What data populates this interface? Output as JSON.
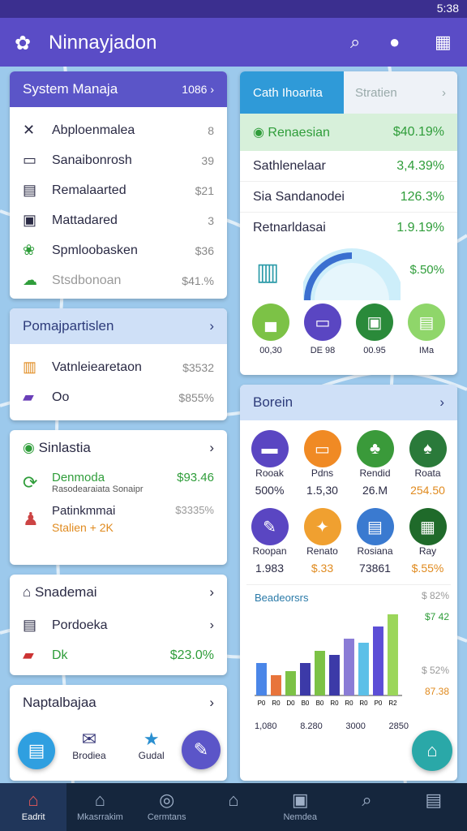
{
  "status_bar": {
    "time": "5:38"
  },
  "app_bar": {
    "title": "Ninnayjadon",
    "icons": [
      "search-icon",
      "profile-icon",
      "grid-icon"
    ]
  },
  "system": {
    "title": "System Manaja",
    "badge": "1086",
    "items": [
      {
        "label": "Abploenmalea",
        "value": "8"
      },
      {
        "label": "Sanaibonrosh",
        "value": "39"
      },
      {
        "label": "Remalaarted",
        "value": "$21"
      },
      {
        "label": "Mattadared",
        "value": "3"
      },
      {
        "label": "Spmloobasken",
        "value": "$36"
      },
      {
        "label": "Stsdbonoan",
        "value": "$41.%"
      }
    ]
  },
  "pomaj": {
    "title": "Pomajpartislen",
    "rows": [
      {
        "label": "Vatnleiearetaon",
        "value": "$3532"
      },
      {
        "label": "Oo",
        "value": "$855%"
      }
    ]
  },
  "sinlastia": {
    "title": "Sinlastia",
    "item1": {
      "label": "Denmoda",
      "value": "$93.46",
      "sub": "Rasodearaiata Sonaipr"
    },
    "item2": {
      "label": "Patinkmmai",
      "value": "$3335%",
      "sub": "Stalien + 2K"
    }
  },
  "snadema": {
    "title": "Snademai",
    "row2": "Pordoeka",
    "row3": {
      "label": "Dk",
      "value": "$23.0%"
    }
  },
  "napta": {
    "title": "Naptalbajaa",
    "buttons": [
      {
        "label": "Brodiea"
      },
      {
        "label": "Gudal"
      }
    ]
  },
  "finance": {
    "tab_active": "Cath Ihoarita",
    "tab_inactive": "Stratien",
    "highlight": {
      "label": "Renaesian",
      "value": "$40.19%"
    },
    "rows": [
      {
        "label": "Sathlenelaar",
        "value": "3,4.39%"
      },
      {
        "label": "Sia Sandanodei",
        "value": "126.3%"
      },
      {
        "label": "Retnarldasai",
        "value": "1.9.19%"
      }
    ],
    "gauge_value": "$.50%",
    "circles": [
      {
        "label": "00,30"
      },
      {
        "label": "DE 98"
      },
      {
        "label": "00.95"
      },
      {
        "label": "IMa"
      }
    ]
  },
  "borein": {
    "title": "Borein",
    "tiles": [
      {
        "label": "Rooak",
        "value": "500%"
      },
      {
        "label": "Pdns",
        "value": "1.5,30"
      },
      {
        "label": "Rendid",
        "value": "26.M"
      },
      {
        "label": "Roata",
        "value": "254.50"
      },
      {
        "label": "Roopan",
        "value": "1.983"
      },
      {
        "label": "Renato",
        "value": "$.33"
      },
      {
        "label": "Rosiana",
        "value": "73861"
      },
      {
        "label": "Ray",
        "value": "$.55%"
      }
    ]
  },
  "chart": {
    "title": "Beadeorsrs",
    "labels": [
      "$ 82%",
      "$7 42",
      "$ 52%",
      "87.38"
    ],
    "bottom": [
      "1,080",
      "8.280",
      "3000",
      "2850"
    ]
  },
  "chart_data": {
    "type": "bar",
    "categories": [
      "P0",
      "R0",
      "D0",
      "B0",
      "B0",
      "R0",
      "R0",
      "R0",
      "P0",
      "R2"
    ],
    "values": [
      40,
      25,
      30,
      40,
      55,
      50,
      70,
      65,
      85,
      100
    ],
    "ylim": [
      0,
      100
    ],
    "colors": [
      "#4a86e8",
      "#e8743b",
      "#7cc246",
      "#3c3aa8",
      "#7cc246",
      "#3c3aa8",
      "#8a7cd6",
      "#5cc0e8",
      "#5c4ed6",
      "#9bd65a"
    ]
  },
  "bottom_nav": [
    {
      "label": "Eadrit",
      "icon": "home-icon"
    },
    {
      "label": "Mkasrrakim",
      "icon": "house-icon"
    },
    {
      "label": "Cermtans",
      "icon": "compass-icon"
    },
    {
      "label": "",
      "icon": "home-outline-icon"
    },
    {
      "label": "Nemdea",
      "icon": "inbox-icon"
    },
    {
      "label": "",
      "icon": "search-icon"
    },
    {
      "label": "",
      "icon": "layers-icon"
    }
  ],
  "colors": {
    "appbar": "#5a4cc6",
    "accent": "#2f9d3a",
    "map": "#9cc9ec",
    "nav": "#15263d"
  }
}
